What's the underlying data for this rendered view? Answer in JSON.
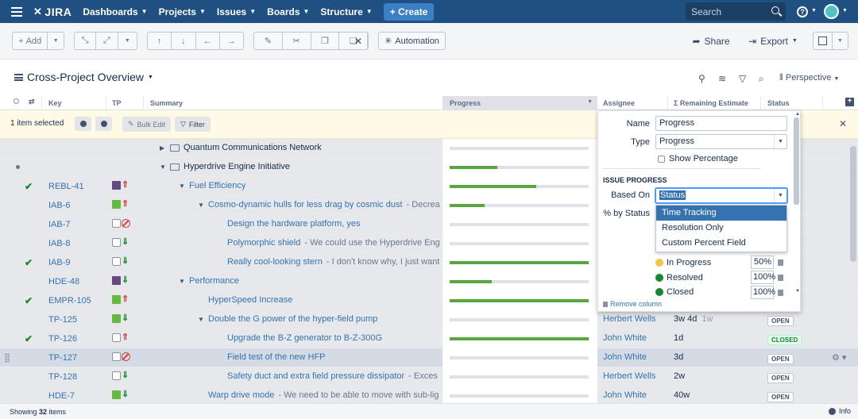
{
  "app": {
    "logo": "JIRA"
  },
  "nav": {
    "items": [
      "Dashboards",
      "Projects",
      "Issues",
      "Boards",
      "Structure"
    ],
    "create_label": "+ Create",
    "search_placeholder": "Search"
  },
  "toolbar": {
    "add_label": "Add",
    "automation_label": "Automation",
    "share_label": "Share",
    "export_label": "Export"
  },
  "page": {
    "title": "Cross-Project Overview",
    "perspective_label": "Perspective"
  },
  "columns": {
    "key": "Key",
    "tp": "TP",
    "summary": "Summary",
    "progress": "Progress",
    "assignee": "Assignee",
    "remaining": "Σ Remaining Estimate",
    "status": "Status"
  },
  "selection": {
    "text": "1 item selected",
    "bulk_edit": "Bulk Edit",
    "filter": "Filter"
  },
  "rows": [
    {
      "key": "",
      "check": false,
      "dot": false,
      "type": "",
      "priority": "",
      "indent": 0,
      "twisty": "▶",
      "folder": true,
      "label": "Quantum Communications Network",
      "desc": "",
      "progress": 0,
      "assignee": "",
      "est": "",
      "est2": "",
      "status": "",
      "status_class": "",
      "highlight": false
    },
    {
      "key": "",
      "check": false,
      "dot": true,
      "type": "",
      "priority": "",
      "indent": 0,
      "twisty": "▼",
      "folder": true,
      "label": "Hyperdrive Engine Initiative",
      "desc": "",
      "progress": 0.34,
      "assignee": "",
      "est": "",
      "est2": "",
      "status": "",
      "status_class": "",
      "highlight": false
    },
    {
      "key": "REBL-41",
      "check": true,
      "dot": false,
      "type": "epic",
      "priority": "high",
      "indent": 1,
      "twisty": "▼",
      "folder": false,
      "label": "Fuel Efficiency",
      "desc": "",
      "progress": 0.62,
      "assignee": "",
      "est": "",
      "est2": "",
      "status": "",
      "status_class": "",
      "highlight": false
    },
    {
      "key": "IAB-6",
      "check": false,
      "dot": false,
      "type": "story",
      "priority": "high",
      "indent": 2,
      "twisty": "▼",
      "folder": false,
      "label": "Cosmo-dynamic hulls for less drag by cosmic dust",
      "desc": "Decrea",
      "progress": 0.25,
      "assignee": "",
      "est": "",
      "est2": "",
      "status": "",
      "status_class": "",
      "highlight": false
    },
    {
      "key": "IAB-7",
      "check": false,
      "dot": false,
      "type": "sub",
      "priority": "block",
      "indent": 3,
      "twisty": "",
      "folder": false,
      "label": "Design the hardware platform, yes",
      "desc": "",
      "progress": 0,
      "assignee": "",
      "est": "",
      "est2": "",
      "status": "",
      "status_class": "",
      "highlight": false
    },
    {
      "key": "IAB-8",
      "check": false,
      "dot": false,
      "type": "sub",
      "priority": "low",
      "indent": 3,
      "twisty": "",
      "folder": false,
      "label": "Polymorphic shield",
      "desc": "We could use the Hyperdrive Eng",
      "progress": 0,
      "assignee": "",
      "est": "",
      "est2": "",
      "status": "",
      "status_class": "",
      "highlight": false
    },
    {
      "key": "IAB-9",
      "check": true,
      "dot": false,
      "type": "sub",
      "priority": "low",
      "indent": 3,
      "twisty": "",
      "folder": false,
      "label": "Really cool-looking stern",
      "desc": "I don't know why, I just want",
      "progress": 1.0,
      "assignee": "",
      "est": "",
      "est2": "",
      "status": "",
      "status_class": "",
      "highlight": false
    },
    {
      "key": "HDE-48",
      "check": false,
      "dot": false,
      "type": "epic",
      "priority": "low",
      "indent": 1,
      "twisty": "▼",
      "folder": false,
      "label": "Performance",
      "desc": "",
      "progress": 0.3,
      "assignee": "",
      "est": "",
      "est2": "",
      "status": "",
      "status_class": "",
      "highlight": false
    },
    {
      "key": "EMPR-105",
      "check": true,
      "dot": false,
      "type": "story",
      "priority": "high",
      "indent": 2,
      "twisty": "",
      "folder": false,
      "label": "HyperSpeed Increase",
      "desc": "",
      "progress": 1.0,
      "assignee": "",
      "est": "",
      "est2": "",
      "status": "",
      "status_class": "",
      "highlight": false
    },
    {
      "key": "TP-125",
      "check": false,
      "dot": false,
      "type": "story",
      "priority": "low",
      "indent": 2,
      "twisty": "▼",
      "folder": false,
      "label": "Double the G power of the hyper-field pump",
      "desc": "",
      "progress": 0,
      "assignee": "Herbert Wells",
      "est": "3w 4d",
      "est2": "1w",
      "status": "OPEN",
      "status_class": "open",
      "highlight": false
    },
    {
      "key": "TP-126",
      "check": true,
      "dot": false,
      "type": "sub",
      "priority": "high",
      "indent": 3,
      "twisty": "",
      "folder": false,
      "label": "Upgrade the B-Z generator to B-Z-300G",
      "desc": "",
      "progress": 1.0,
      "assignee": "John White",
      "est": "1d",
      "est2": "",
      "status": "CLOSED",
      "status_class": "closed",
      "highlight": false
    },
    {
      "key": "TP-127",
      "check": false,
      "dot": false,
      "type": "sub",
      "priority": "block",
      "indent": 3,
      "twisty": "",
      "folder": false,
      "label": "Field test of the new HFP",
      "desc": "",
      "progress": 0,
      "assignee": "John White",
      "est": "3d",
      "est2": "",
      "status": "OPEN",
      "status_class": "open",
      "highlight": true
    },
    {
      "key": "TP-128",
      "check": false,
      "dot": false,
      "type": "sub",
      "priority": "low",
      "indent": 3,
      "twisty": "",
      "folder": false,
      "label": "Safety duct and extra field pressure dissipator",
      "desc": "Exces",
      "progress": 0,
      "assignee": "Herbert Wells",
      "est": "2w",
      "est2": "",
      "status": "OPEN",
      "status_class": "open",
      "highlight": false
    },
    {
      "key": "HDE-7",
      "check": false,
      "dot": false,
      "type": "story",
      "priority": "low",
      "indent": 2,
      "twisty": "",
      "folder": false,
      "label": "Warp drive mode",
      "desc": "We need to be able to move with sub-lig",
      "progress": 0,
      "assignee": "John White",
      "est": "40w",
      "est2": "",
      "status": "OPEN",
      "status_class": "open",
      "highlight": false
    }
  ],
  "popup": {
    "name_label": "Name",
    "name_value": "Progress",
    "type_label": "Type",
    "type_value": "Progress",
    "show_pct_label": "Show Percentage",
    "section_title": "ISSUE PROGRESS",
    "based_on_label": "Based On",
    "based_on_value": "Status",
    "pct_by_status_label": "% by Status",
    "options": [
      "Time Tracking",
      "Resolution Only",
      "Custom Percent Field"
    ],
    "statuses": [
      {
        "name": "In Progress",
        "pct": "50",
        "color": "#f6c342"
      },
      {
        "name": "Resolved",
        "pct": "100",
        "color": "#14892c"
      },
      {
        "name": "Closed",
        "pct": "100",
        "color": "#14892c"
      }
    ],
    "remove_label": "Remove column"
  },
  "footer": {
    "showing_prefix": "Showing ",
    "showing_count": "32",
    "showing_suffix": " items",
    "info_label": "Info"
  }
}
